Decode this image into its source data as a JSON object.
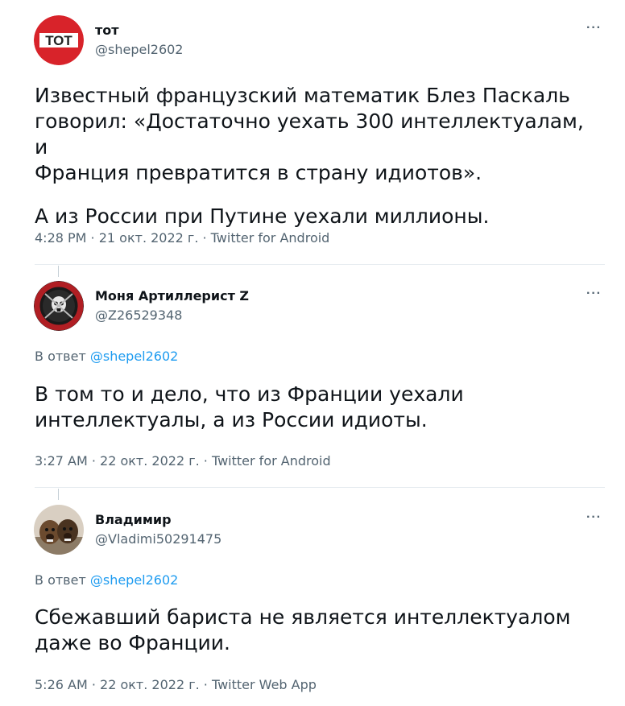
{
  "tweets": [
    {
      "name": "тот",
      "handle": "@shepel2602",
      "avatar_text": "ТОТ",
      "text_lines": [
        "Известный французский математик Блез Паскаль",
        "говорил: «Достаточно уехать 300 интеллектуалам, и",
        "Франция превратится в страну идиотов»."
      ],
      "text_para2": "А из России при Путине уехали миллионы.",
      "meta": "4:28 PM · 21 окт. 2022 г. · Twitter for Android"
    },
    {
      "name": "Моня Артиллерист Z",
      "handle": "@Z26529348",
      "avatar_text": "PMC Wagner Group · Группа Вагнера",
      "reply_prefix": "В ответ",
      "reply_handle": "@shepel2602",
      "text_lines": [
        "В том то и дело, что из Франции уехали",
        "интеллектуалы, а из России идиоты."
      ],
      "meta": "3:27 AM · 22 окт. 2022 г. · Twitter for Android"
    },
    {
      "name": "Владимир",
      "handle": "@Vladimi50291475",
      "reply_prefix": "В ответ",
      "reply_handle": "@shepel2602",
      "text_lines": [
        "Сбежавший бариста не является интеллектуалом",
        "даже во Франции."
      ],
      "meta": "5:26 AM · 22 окт. 2022 г. · Twitter Web App"
    }
  ],
  "more_label": "···",
  "colors": {
    "accent": "#1d9bf0",
    "secondary": "#536471",
    "text": "#0f1419"
  }
}
